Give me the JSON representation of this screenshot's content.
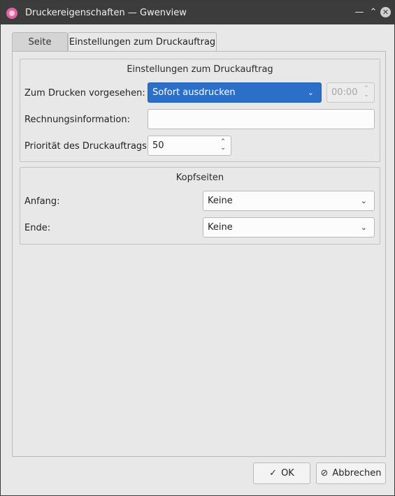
{
  "window": {
    "title": "Druckereigenschaften — Gwenview",
    "icons": {
      "app": "gwenview-icon",
      "minimize": "minimize-icon",
      "maximize": "maximize-icon",
      "close": "close-icon"
    }
  },
  "tabs": [
    {
      "label": "Seite",
      "active": false
    },
    {
      "label": "Einstellungen zum Druckauftrag",
      "active": true
    }
  ],
  "job_group": {
    "title": "Einstellungen zum Druckauftrag",
    "schedule_label": "Zum Drucken vorgesehen:",
    "schedule_value": "Sofort ausdrucken",
    "time_value": "00:00",
    "billing_label": "Rechnungsinformation:",
    "billing_value": "",
    "priority_label": "Priorität des Druckauftrags:",
    "priority_value": "50"
  },
  "banner_group": {
    "title": "Kopfseiten",
    "start_label": "Anfang:",
    "start_value": "Keine",
    "end_label": "Ende:",
    "end_value": "Keine"
  },
  "buttons": {
    "ok_label": "OK",
    "cancel_label": "Abbrechen"
  },
  "colors": {
    "accent": "#2c6fc8",
    "titlebar": "#3c3c3c",
    "window_bg": "#e8e8e8"
  }
}
